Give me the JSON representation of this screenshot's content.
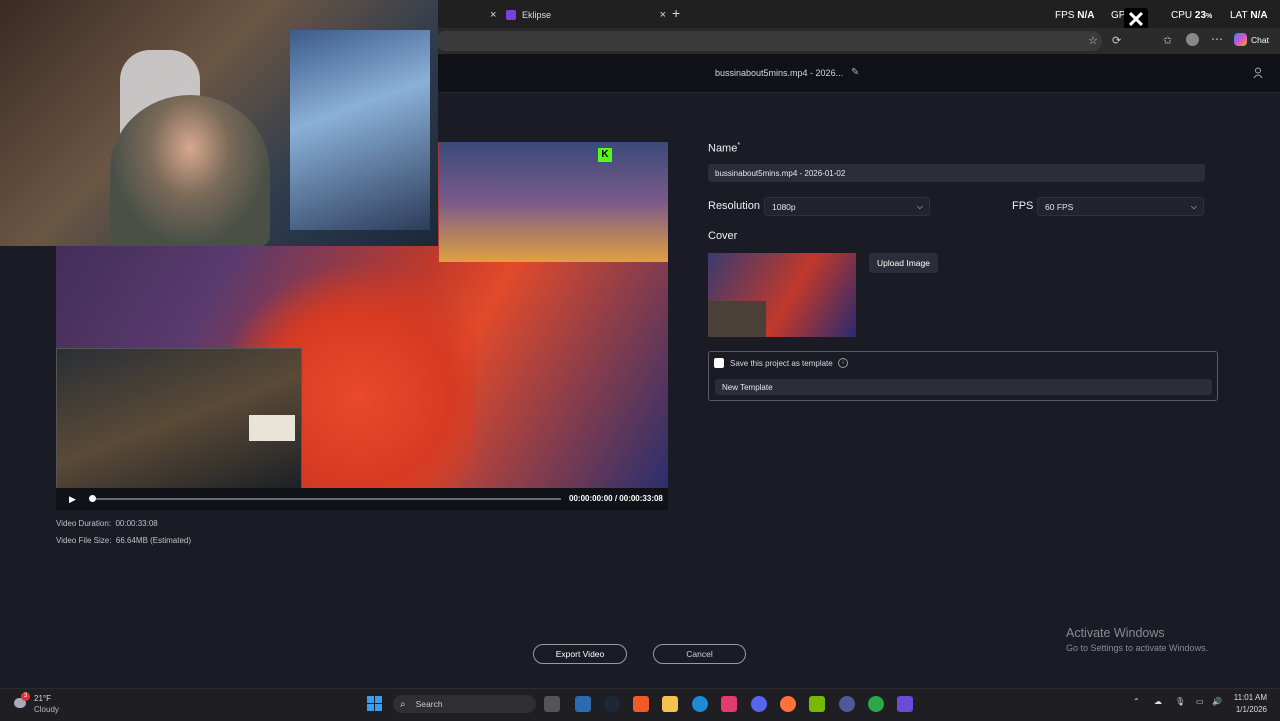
{
  "browser": {
    "tabs": [
      {
        "label": "Eklipse"
      }
    ],
    "new_tab": "+",
    "close_tab": "×",
    "copilot_label": "Chat"
  },
  "overlay_hud": {
    "fps_label": "FPS",
    "fps_value": "N/A",
    "gpu_label": "GPU",
    "cpu_label": "CPU",
    "cpu_value": "23",
    "cpu_unit": "%",
    "lat_label": "LAT",
    "lat_value": "N/A"
  },
  "header": {
    "title": "bussinabout5mins.mp4 - 2026...",
    "edit_icon": "pencil-icon",
    "user_icon": "user-icon"
  },
  "player": {
    "current_time": "00:00:00:00",
    "separator": "/",
    "total_time": "00:00:33:08",
    "progress_fraction": 0.0
  },
  "video_info": {
    "duration_label": "Video Duration:",
    "duration_value": "00:00:33:08",
    "size_label": "Video File Size:",
    "size_value": "66.64MB (Estimated)"
  },
  "form": {
    "name_label": "Name",
    "required_mark": "*",
    "name_value": "bussinabout5mins.mp4 - 2026-01-02",
    "resolution_label": "Resolution",
    "resolution_value": "1080p",
    "fps_label": "FPS",
    "fps_value": "60 FPS",
    "cover_label": "Cover",
    "upload_label": "Upload Image",
    "template_checkbox_label": "Save this project as template",
    "template_checked": false,
    "template_name_value": "New Template"
  },
  "actions": {
    "export_label": "Export Video",
    "cancel_label": "Cancel"
  },
  "watermark": {
    "title": "Activate Windows",
    "subtitle": "Go to Settings to activate Windows."
  },
  "taskbar": {
    "weather_temp": "21°F",
    "weather_desc": "Cloudy",
    "weather_badge": "3",
    "search_placeholder": "Search",
    "time": "11:01 AM",
    "date": "1/1/2026"
  },
  "colors": {
    "app_bg": "#1a1b24",
    "panel_field": "#2c2d38",
    "button_border": "#9a9aa6"
  }
}
